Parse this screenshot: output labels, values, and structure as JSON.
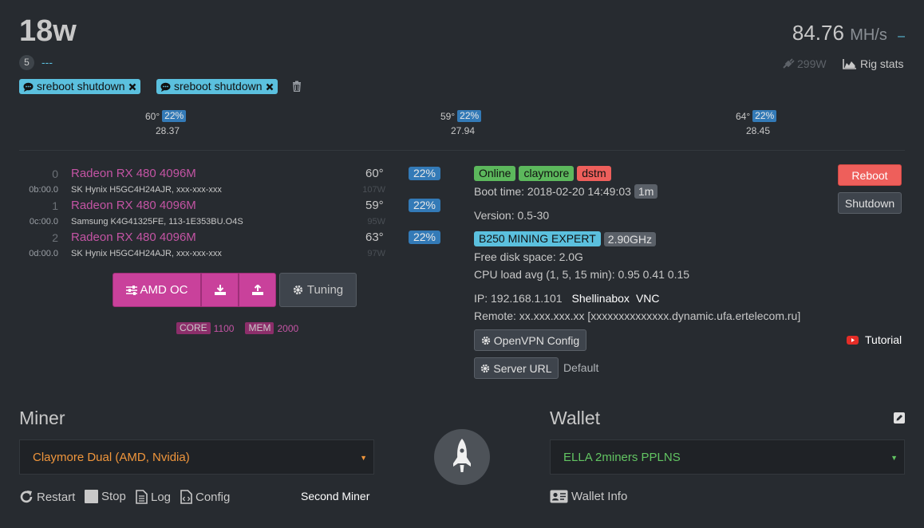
{
  "header": {
    "title": "18w",
    "worker_id": "5",
    "description": "---",
    "tags": [
      "sreboot shutdown",
      "sreboot shutdown"
    ],
    "hashrate_value": "84.76",
    "hashrate_unit": "MH/s",
    "hashrate_dash": "–",
    "power": "299W",
    "rig_stats": "Rig stats"
  },
  "gpu_summary": [
    {
      "temp": "60°",
      "fan": "22%",
      "hash": "28.37"
    },
    {
      "temp": "59°",
      "fan": "22%",
      "hash": "27.94"
    },
    {
      "temp": "64°",
      "fan": "22%",
      "hash": "28.45"
    }
  ],
  "gpus": [
    {
      "index": "0",
      "name": "Radeon RX 480 4096M",
      "bus": "0b:00.0",
      "memory": "SK Hynix H5GC4H24AJR, xxx-xxx-xxx",
      "temp": "60°",
      "watts": "107W",
      "fan": "22%"
    },
    {
      "index": "1",
      "name": "Radeon RX 480 4096M",
      "bus": "0c:00.0",
      "memory": "Samsung K4G41325FE, 113-1E353BU.O4S",
      "temp": "59°",
      "watts": "95W",
      "fan": "22%"
    },
    {
      "index": "2",
      "name": "Radeon RX 480 4096M",
      "bus": "0d:00.0",
      "memory": "SK Hynix H5GC4H24AJR, xxx-xxx-xxx",
      "temp": "63°",
      "watts": "97W",
      "fan": "22%"
    }
  ],
  "overclock": {
    "amd_oc_label": "AMD OC",
    "tuning_label": "Tuning",
    "core_label": "CORE",
    "core_value": "1100",
    "mem_label": "MEM",
    "mem_value": "2000"
  },
  "status": {
    "online": "Online",
    "miner": "claymore",
    "miner2": "dstm",
    "boot_time": "Boot time: 2018-02-20 14:49:03",
    "uptime": "1m",
    "version": "Version: 0.5-30",
    "motherboard": "B250 MINING EXPERT",
    "cpu_freq": "2.90GHz",
    "disk": "Free disk space: 2.0G",
    "cpu_load": "CPU load avg (1, 5, 15 min): 0.95 0.41 0.15",
    "ip": "IP: 192.168.1.101",
    "shellinabox": "Shellinabox",
    "vnc": "VNC",
    "remote": "Remote: xx.xxx.xxx.xx [xxxxxxxxxxxxxx.dynamic.ufa.ertelecom.ru]",
    "openvpn_label": "OpenVPN Config",
    "server_url_label": "Server URL",
    "server_url_value": "Default",
    "tutorial": "Tutorial"
  },
  "actions": {
    "reboot": "Reboot",
    "shutdown": "Shutdown"
  },
  "miner": {
    "heading": "Miner",
    "selected": "Claymore Dual (AMD, Nvidia)",
    "restart": "Restart",
    "stop": "Stop",
    "log": "Log",
    "config": "Config",
    "second_miner": "Second Miner"
  },
  "wallet": {
    "heading": "Wallet",
    "selected": "ELLA 2miners PPLNS",
    "info": "Wallet Info"
  },
  "colors": {
    "accent_pink": "#c9419b",
    "online_green": "#5cb85c",
    "danger_red": "#ee5f5b",
    "info_blue": "#5bc0de",
    "miner_orange": "#f0963c",
    "wallet_green": "#62c462"
  }
}
